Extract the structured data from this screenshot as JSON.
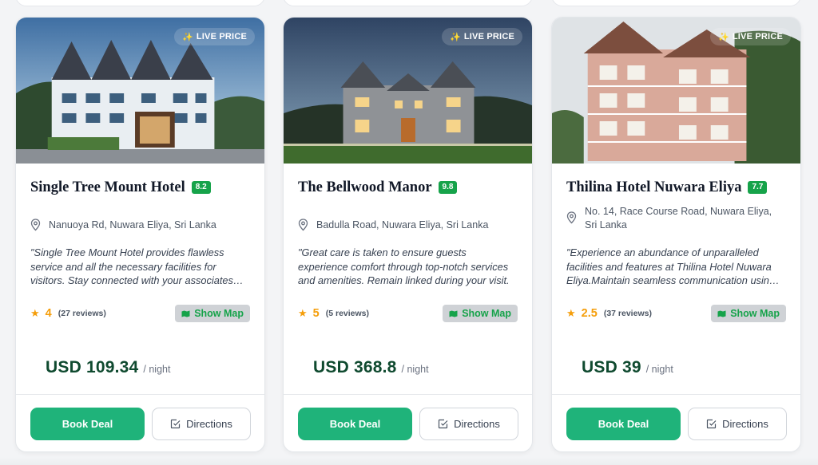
{
  "live_badge_label": "LIVE PRICE",
  "labels": {
    "show_map": "Show Map",
    "per_night": "/ night",
    "book_deal": "Book Deal",
    "directions": "Directions"
  },
  "colors": {
    "accent_green": "#1fb37a",
    "rating_green": "#16a34a",
    "star_orange": "#f59e0b",
    "price_dark_green": "#0f4a2f"
  },
  "icons": {
    "badge": "sparkle-icon",
    "address": "map-pin-icon",
    "rating": "star-icon",
    "map": "map-icon",
    "directions": "check-square-icon"
  },
  "hotels": [
    {
      "name": "Single Tree Mount Hotel",
      "score": "8.2",
      "address": "Nanuoya Rd, Nuwara Eliya, Sri Lanka",
      "description": "\"Single Tree Mount Hotel provides flawless service and all the necessary facilities for visitors. Stay connected with your associates during your stay.",
      "stars": "4",
      "reviews": "(27 reviews)",
      "price": "USD 109.34"
    },
    {
      "name": "The Bellwood Manor",
      "score": "9.8",
      "address": "Badulla Road, Nuwara Eliya, Sri Lanka",
      "description": "\"Great care is taken to ensure guests experience comfort through top-notch services and amenities. Remain linked during your visit.",
      "stars": "5",
      "reviews": "(5 reviews)",
      "price": "USD 368.8"
    },
    {
      "name": "Thilina Hotel Nuwara Eliya",
      "score": "7.7",
      "address": "No. 14, Race Course Road, Nuwara Eliya, Sri Lanka",
      "description": "\"Experience an abundance of unparalleled facilities and features at Thilina Hotel Nuwara Eliya.Maintain seamless communication using the free WiFi.",
      "stars": "2.5",
      "reviews": "(37 reviews)",
      "price": "USD 39"
    }
  ]
}
